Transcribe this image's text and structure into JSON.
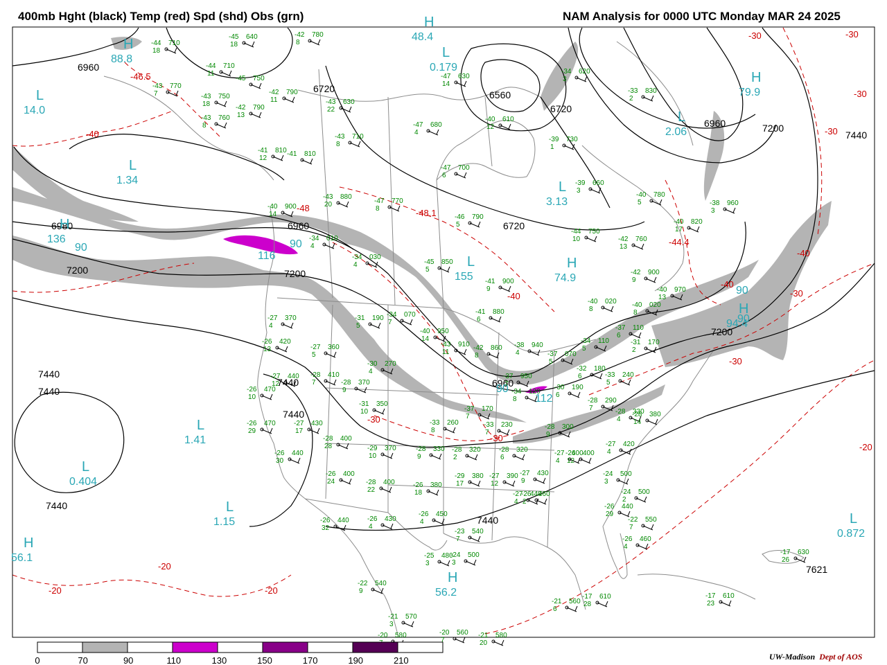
{
  "header": {
    "title_left": "400mb Hght (black) Temp (red) Spd (shd) Obs (grn)",
    "title_right": "NAM Analysis for 0000 UTC Monday  MAR 24 2025"
  },
  "colors": {
    "height_contours": "#000000",
    "temperature_contours": "#cc0000",
    "speed_70_90": "#b4b4b4",
    "speed_90_110": "#ffffff",
    "speed_110_130": "#cc00cc",
    "speed_130_150": "#ffffff",
    "speed_150_170": "#880088",
    "speed_170_190": "#ffffff",
    "speed_190_210": "#550055",
    "obs": "#008800",
    "centers": "#2aa7b5",
    "geography": "#8c8c8c"
  },
  "colorbar": {
    "ticks": [
      "0",
      "70",
      "90",
      "110",
      "130",
      "150",
      "170",
      "190",
      "210"
    ]
  },
  "credit": {
    "org": "UW-Madison",
    "dept": "Dept of AOS"
  },
  "height_labels": [
    {
      "text": "6960"
    },
    {
      "text": "6720"
    },
    {
      "text": "6560"
    },
    {
      "text": "6720"
    },
    {
      "text": "6960"
    },
    {
      "text": "7200"
    },
    {
      "text": "7440"
    },
    {
      "text": "6980"
    },
    {
      "text": "6960"
    },
    {
      "text": "7200"
    },
    {
      "text": "7200"
    },
    {
      "text": "6720"
    },
    {
      "text": "7200"
    },
    {
      "text": "7440"
    },
    {
      "text": "7440"
    },
    {
      "text": "7440"
    },
    {
      "text": "7440"
    },
    {
      "text": "7440"
    },
    {
      "text": "7440"
    },
    {
      "text": "7621"
    },
    {
      "text": "6960"
    }
  ],
  "temp_labels": [
    {
      "text": "-46.5"
    },
    {
      "text": "-40"
    },
    {
      "text": "-48"
    },
    {
      "text": "-48.1"
    },
    {
      "text": "-40"
    },
    {
      "text": "-30"
    },
    {
      "text": "-30"
    },
    {
      "text": "-30"
    },
    {
      "text": "-20"
    },
    {
      "text": "-20"
    },
    {
      "text": "-20"
    },
    {
      "text": "-30"
    },
    {
      "text": "-44.4"
    },
    {
      "text": "-40"
    },
    {
      "text": "-30"
    },
    {
      "text": "-30"
    },
    {
      "text": "-40"
    },
    {
      "text": "-30"
    },
    {
      "text": "-30"
    },
    {
      "text": "-20"
    }
  ],
  "centers": [
    {
      "letter": "H",
      "value": "88.8"
    },
    {
      "letter": "L",
      "value": "14.0"
    },
    {
      "letter": "L",
      "value": "1.34"
    },
    {
      "letter": "H",
      "value": "136"
    },
    {
      "letter": "L",
      "value": "1.41"
    },
    {
      "letter": "L",
      "value": "0.404"
    },
    {
      "letter": "L",
      "value": "1.15"
    },
    {
      "letter": "H",
      "value": "56.1"
    },
    {
      "letter": "H",
      "value": "56.2"
    },
    {
      "letter": "L",
      "value": "155"
    },
    {
      "letter": "H",
      "value": "74.9"
    },
    {
      "letter": "L",
      "value": "3.13"
    },
    {
      "letter": "L",
      "value": "2.06"
    },
    {
      "letter": "H",
      "value": "79.9"
    },
    {
      "letter": "H",
      "value": "94.4"
    },
    {
      "letter": "L",
      "value": "0.872"
    },
    {
      "letter": "H",
      "value": "48.4"
    },
    {
      "letter": "L",
      "value": "0.179"
    }
  ],
  "speed_labels": [
    {
      "text": "90"
    },
    {
      "text": "116"
    },
    {
      "text": "90"
    },
    {
      "text": "90"
    },
    {
      "text": "112"
    },
    {
      "text": "90"
    },
    {
      "text": "90"
    }
  ],
  "observations": [
    {
      "t": "-45",
      "h": "640",
      "d": "18"
    },
    {
      "t": "-44",
      "h": "710",
      "d": "18"
    },
    {
      "t": "-44",
      "h": "710",
      "d": "11"
    },
    {
      "t": "-45",
      "h": "750",
      "d": ""
    },
    {
      "t": "-43",
      "h": "770",
      "d": "7"
    },
    {
      "t": "-43",
      "h": "750",
      "d": "18"
    },
    {
      "t": "-42",
      "h": "790",
      "d": "13"
    },
    {
      "t": "-43",
      "h": "760",
      "d": "8"
    },
    {
      "t": "-42",
      "h": "790",
      "d": "11"
    },
    {
      "t": "-42",
      "h": "780",
      "d": "8"
    },
    {
      "t": "-43",
      "h": "630",
      "d": "22"
    },
    {
      "t": "-47",
      "h": "630",
      "d": "14"
    },
    {
      "t": "-43",
      "h": "710",
      "d": "8"
    },
    {
      "t": "-47",
      "h": "680",
      "d": "4"
    },
    {
      "t": "-40",
      "h": "610",
      "d": "12"
    },
    {
      "t": "-34",
      "h": "620",
      "d": "3"
    },
    {
      "t": "-33",
      "h": "830",
      "d": "2"
    },
    {
      "t": "-39",
      "h": "730",
      "d": "1"
    },
    {
      "t": "-41",
      "h": "810",
      "d": "12"
    },
    {
      "t": "-41",
      "h": "810",
      "d": ""
    },
    {
      "t": "-47",
      "h": "700",
      "d": "6"
    },
    {
      "t": "-39",
      "h": "660",
      "d": "3"
    },
    {
      "t": "-40",
      "h": "780",
      "d": "5"
    },
    {
      "t": "-38",
      "h": "960",
      "d": "3"
    },
    {
      "t": "-43",
      "h": "880",
      "d": "20"
    },
    {
      "t": "-47",
      "h": "770",
      "d": "8"
    },
    {
      "t": "-40",
      "h": "900",
      "d": "14"
    },
    {
      "t": "-46",
      "h": "790",
      "d": "5"
    },
    {
      "t": "-40",
      "h": "820",
      "d": "17"
    },
    {
      "t": "-44",
      "h": "750",
      "d": "10"
    },
    {
      "t": "-42",
      "h": "760",
      "d": "13"
    },
    {
      "t": "-34",
      "h": "010",
      "d": "4"
    },
    {
      "t": "-34",
      "h": "030",
      "d": "4"
    },
    {
      "t": "-45",
      "h": "850",
      "d": "5"
    },
    {
      "t": "-41",
      "h": "900",
      "d": "9"
    },
    {
      "t": "-42",
      "h": "900",
      "d": "9"
    },
    {
      "t": "-40",
      "h": "970",
      "d": "13"
    },
    {
      "t": "-40",
      "h": "020",
      "d": "8"
    },
    {
      "t": "-40",
      "h": "020",
      "d": "8"
    },
    {
      "t": "-27",
      "h": "370",
      "d": "4"
    },
    {
      "t": "-31",
      "h": "190",
      "d": "5"
    },
    {
      "t": "-34",
      "h": "070",
      "d": "7"
    },
    {
      "t": "-41",
      "h": "880",
      "d": "6"
    },
    {
      "t": "-40",
      "h": "950",
      "d": "14"
    },
    {
      "t": "-43",
      "h": "910",
      "d": "11"
    },
    {
      "t": "-42",
      "h": "860",
      "d": "8"
    },
    {
      "t": "-38",
      "h": "940",
      "d": "4"
    },
    {
      "t": "-37",
      "h": "110",
      "d": "6"
    },
    {
      "t": "-34",
      "h": "110",
      "d": "5"
    },
    {
      "t": "-31",
      "h": "170",
      "d": "2"
    },
    {
      "t": "-26",
      "h": "420",
      "d": "13"
    },
    {
      "t": "-27",
      "h": "360",
      "d": "5"
    },
    {
      "t": "-30",
      "h": "270",
      "d": "4"
    },
    {
      "t": "-37",
      "h": "070",
      "d": "5"
    },
    {
      "t": "-32",
      "h": "180",
      "d": "6"
    },
    {
      "t": "-33",
      "h": "240",
      "d": "5"
    },
    {
      "t": "-27",
      "h": "440",
      "d": "12"
    },
    {
      "t": "-28",
      "h": "410",
      "d": "7"
    },
    {
      "t": "-28",
      "h": "370",
      "d": "9"
    },
    {
      "t": "-37",
      "h": "950",
      "d": "7"
    },
    {
      "t": "-34",
      "h": "120",
      "d": "8"
    },
    {
      "t": "-30",
      "h": "190",
      "d": "6"
    },
    {
      "t": "-26",
      "h": "470",
      "d": "10"
    },
    {
      "t": "-31",
      "h": "350",
      "d": "10"
    },
    {
      "t": "-37",
      "h": "170",
      "d": "7"
    },
    {
      "t": "-28",
      "h": "290",
      "d": "7"
    },
    {
      "t": "-28",
      "h": "330",
      "d": "4"
    },
    {
      "t": "-28",
      "h": "380",
      "d": "14"
    },
    {
      "t": "-26",
      "h": "470",
      "d": "29"
    },
    {
      "t": "-27",
      "h": "430",
      "d": "17"
    },
    {
      "t": "-33",
      "h": "260",
      "d": "8"
    },
    {
      "t": "-33",
      "h": "230",
      "d": "7"
    },
    {
      "t": "-28",
      "h": "300",
      "d": "9"
    },
    {
      "t": "-28",
      "h": "400",
      "d": "28"
    },
    {
      "t": "-26",
      "h": "440",
      "d": "30"
    },
    {
      "t": "-29",
      "h": "370",
      "d": "10"
    },
    {
      "t": "-28",
      "h": "330",
      "d": "9"
    },
    {
      "t": "-28",
      "h": "320",
      "d": "2"
    },
    {
      "t": "-28",
      "h": "320",
      "d": "6"
    },
    {
      "t": "-27",
      "h": "420",
      "d": "4"
    },
    {
      "t": "-27",
      "h": "400",
      "d": "4"
    },
    {
      "t": "-26",
      "h": "400",
      "d": "12"
    },
    {
      "t": "-26",
      "h": "400",
      "d": "24"
    },
    {
      "t": "-28",
      "h": "400",
      "d": "22"
    },
    {
      "t": "-26",
      "h": "380",
      "d": "18"
    },
    {
      "t": "-29",
      "h": "380",
      "d": "17"
    },
    {
      "t": "-27",
      "h": "390",
      "d": "12"
    },
    {
      "t": "-27",
      "h": "430",
      "d": "9"
    },
    {
      "t": "-27",
      "h": "440",
      "d": "4"
    },
    {
      "t": "-26",
      "h": "460",
      "d": "2"
    },
    {
      "t": "-24",
      "h": "500",
      "d": "3"
    },
    {
      "t": "-24",
      "h": "500",
      "d": "2"
    },
    {
      "t": "-26",
      "h": "440",
      "d": "29"
    },
    {
      "t": "-26",
      "h": "440",
      "d": "32"
    },
    {
      "t": "-26",
      "h": "430",
      "d": "4"
    },
    {
      "t": "-26",
      "h": "450",
      "d": "4"
    },
    {
      "t": "-23",
      "h": "540",
      "d": "7"
    },
    {
      "t": "-22",
      "h": "550",
      "d": "7"
    },
    {
      "t": "-26",
      "h": "460",
      "d": "4"
    },
    {
      "t": "-25",
      "h": "480",
      "d": "3"
    },
    {
      "t": "-24",
      "h": "500",
      "d": "3"
    },
    {
      "t": "-22",
      "h": "540",
      "d": "9"
    },
    {
      "t": "-21",
      "h": "570",
      "d": "3"
    },
    {
      "t": "-20",
      "h": "580",
      "d": "7"
    },
    {
      "t": "-20",
      "h": "560",
      "d": "7"
    },
    {
      "t": "-21",
      "h": "580",
      "d": "20"
    },
    {
      "t": "-21",
      "h": "560",
      "d": "6"
    },
    {
      "t": "-17",
      "h": "610",
      "d": "28"
    },
    {
      "t": "-17",
      "h": "610",
      "d": "23"
    },
    {
      "t": "-17",
      "h": "630",
      "d": "26"
    }
  ]
}
